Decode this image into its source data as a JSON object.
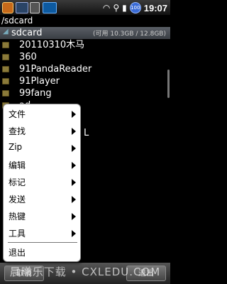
{
  "status_bar": {
    "time": "19:07",
    "battery_badge": "100",
    "icons": [
      "app-notification-icon",
      "image-notification-icon",
      "sd-notification-icon",
      "data-notification-icon",
      "wifi-icon",
      "usb-icon",
      "signal-icon",
      "battery-icon"
    ]
  },
  "path": "/sdcard",
  "files": [
    {
      "name": "sdcard",
      "capacity": "(可用 10.3GB / 12.8GB)",
      "selected": true
    },
    {
      "name": "20110310木马"
    },
    {
      "name": "360"
    },
    {
      "name": "91PandaReader"
    },
    {
      "name": "91Player"
    },
    {
      "name": "99fang"
    },
    {
      "name": "ad"
    }
  ],
  "hidden_partial_text": "L",
  "context_menu": {
    "items": [
      {
        "label": "文件",
        "has_submenu": true
      },
      {
        "label": "查找",
        "has_submenu": true
      },
      {
        "label": "Zip",
        "has_submenu": true
      },
      {
        "label": "编辑",
        "has_submenu": true
      },
      {
        "label": "标记",
        "has_submenu": true
      },
      {
        "label": "发送",
        "has_submenu": true
      },
      {
        "label": "热键",
        "has_submenu": true
      },
      {
        "label": "工具",
        "has_submenu": true
      },
      {
        "label": "退出",
        "has_submenu": false
      }
    ]
  },
  "bottom_bar": {
    "left_label": "取消",
    "right_label": "退出"
  },
  "watermark": "晨曦乐下载 • CXLEDU.COM"
}
